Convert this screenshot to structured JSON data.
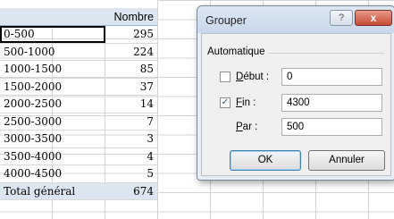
{
  "pivot": {
    "header": {
      "label": "",
      "value": "Nombre"
    },
    "rows": [
      {
        "label": "0-500",
        "value": "295"
      },
      {
        "label": "500-1000",
        "value": "224"
      },
      {
        "label": "1000-1500",
        "value": "85"
      },
      {
        "label": "1500-2000",
        "value": "37"
      },
      {
        "label": "2000-2500",
        "value": "14"
      },
      {
        "label": "2500-3000",
        "value": "7"
      },
      {
        "label": "3000-3500",
        "value": "3"
      },
      {
        "label": "3500-4000",
        "value": "4"
      },
      {
        "label": "4000-4500",
        "value": "5"
      }
    ],
    "total": {
      "label": "Total général",
      "value": "674"
    }
  },
  "dialog": {
    "title": "Grouper",
    "help_label": "?",
    "close_label": "x",
    "group_label": "Automatique",
    "start": {
      "label_prefix": "",
      "label_accel": "D",
      "label_rest": "ébut :",
      "checked": false,
      "value": "0"
    },
    "end": {
      "label_accel": "F",
      "label_rest": "in :",
      "checked": true,
      "value": "4300"
    },
    "by": {
      "label_accel": "P",
      "label_rest": "ar :",
      "value": "500"
    },
    "ok_label": "OK",
    "cancel_label": "Annuler"
  }
}
